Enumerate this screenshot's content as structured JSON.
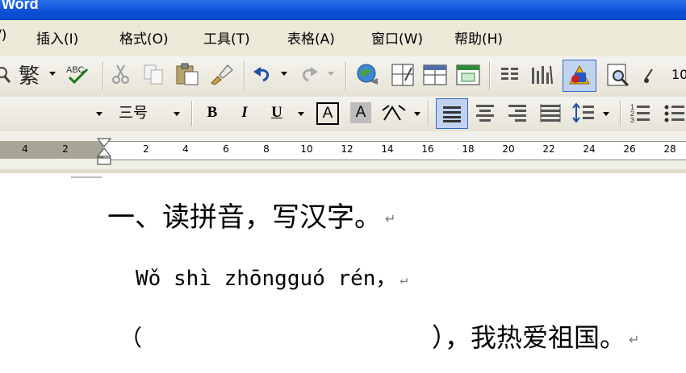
{
  "window": {
    "title": "Word"
  },
  "menu": {
    "items": [
      {
        "label": "/)"
      },
      {
        "label": "插入(I)"
      },
      {
        "label": "格式(O)"
      },
      {
        "label": "工具(T)"
      },
      {
        "label": "表格(A)"
      },
      {
        "label": "窗口(W)"
      },
      {
        "label": "帮助(H)"
      }
    ]
  },
  "toolbar": {
    "traditional_label": "繁",
    "font_size": "三号",
    "bold": "B",
    "italic": "I",
    "underline": "U",
    "char_border": "A",
    "char_shading": "A"
  },
  "ruler": {
    "left_labels": [
      "4",
      "2"
    ],
    "labels": [
      "2",
      "4",
      "6",
      "8",
      "10",
      "12",
      "14",
      "16",
      "18",
      "20",
      "22",
      "24",
      "26",
      "28"
    ]
  },
  "document": {
    "line1": "一、读拼音，写汉字。",
    "line2": "Wǒ shì zhōngguó rén，",
    "line3_open": "（",
    "line3_rest": "），我热爱祖国。",
    "para_mark": "↵"
  }
}
